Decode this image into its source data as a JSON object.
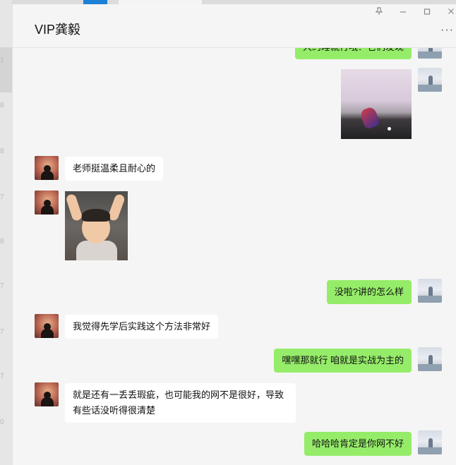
{
  "window": {
    "title": "VIP龚毅",
    "controls": [
      "pin-icon",
      "minimize-icon",
      "maximize-icon",
      "close-icon"
    ],
    "more_label": "···"
  },
  "colors": {
    "self_bubble": "#95ec69",
    "other_bubble": "#ffffff",
    "background": "#f5f5f5"
  },
  "messages": [
    {
      "sender": "self",
      "type": "text",
      "text": "大约睡就行哦？它们发现"
    },
    {
      "sender": "self",
      "type": "image",
      "content": "figurine on dark beach"
    },
    {
      "sender": "other",
      "type": "text",
      "text": "老师挺温柔且耐心的"
    },
    {
      "sender": "other",
      "type": "image",
      "content": "toddler raising hands"
    },
    {
      "sender": "self",
      "type": "text",
      "text": "没啦?讲的怎么样"
    },
    {
      "sender": "other",
      "type": "text",
      "text": "我觉得先学后实践这个方法非常好"
    },
    {
      "sender": "self",
      "type": "text",
      "text": "嘿嘿那就行 咱就是实战为主的"
    },
    {
      "sender": "other",
      "type": "text",
      "text": "就是还有一丢丢瑕疵，也可能我的网不是很好，导致有些话没听得很清楚"
    },
    {
      "sender": "self",
      "type": "text",
      "text": "哈哈哈肯定是你网不好"
    }
  ]
}
